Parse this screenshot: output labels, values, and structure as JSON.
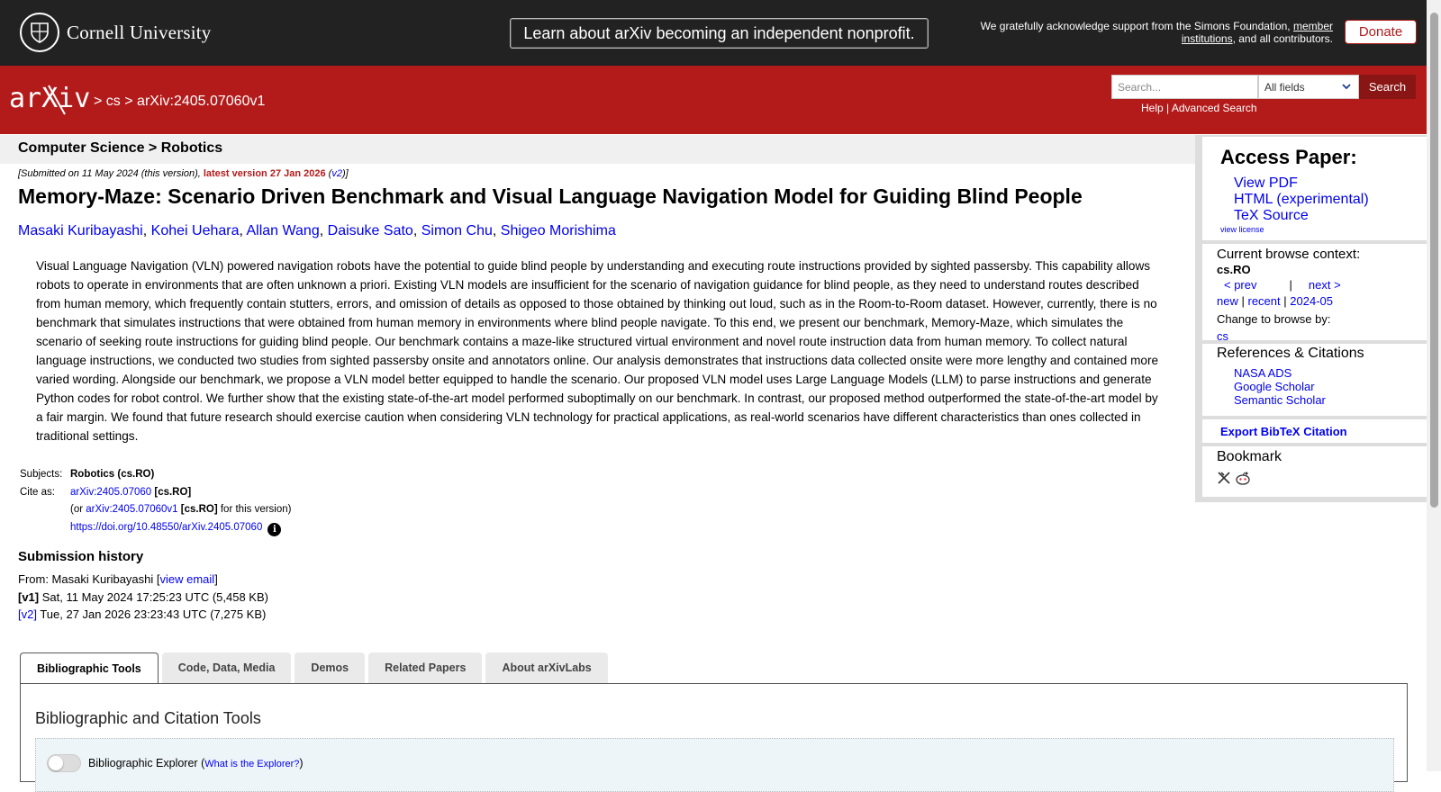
{
  "topbar": {
    "cornell_name": "Cornell University",
    "nonprofit_label": "Learn about arXiv becoming an independent nonprofit.",
    "support_text": "We gratefully acknowledge support from the Simons Foundation,",
    "support_link": "member institutions",
    "support_tail": ", and all contributors.",
    "donate_label": "Donate"
  },
  "header": {
    "logo_text": "arXiv",
    "crumb_sep1": ">",
    "crumb_cs": "cs",
    "crumb_sep2": ">",
    "crumb_paper": "arXiv:2405.07060v1",
    "search_placeholder": "Search...",
    "field_selected": "All fields",
    "search_button": "Search",
    "help": "Help",
    "pipe": "|",
    "advanced": "Advanced Search"
  },
  "paper": {
    "subject_bar": "Computer Science > Robotics",
    "submitted_prefix": "[Submitted on 11 May 2024 (this version), ",
    "latest": "latest version 27 Jan 2026",
    "v2_open": " (",
    "v2": "v2",
    "v2_close": ")]",
    "title": "Memory-Maze: Scenario Driven Benchmark and Visual Language Navigation Model for Guiding Blind People",
    "authors": [
      "Masaki Kuribayashi",
      "Kohei Uehara",
      "Allan Wang",
      "Daisuke Sato",
      "Simon Chu",
      "Shigeo Morishima"
    ],
    "author_sep": ",",
    "abstract": "Visual Language Navigation (VLN) powered navigation robots have the potential to guide blind people by understanding and executing route instructions provided by sighted passersby. This capability allows robots to operate in environments that are often unknown a priori. Existing VLN models are insufficient for the scenario of navigation guidance for blind people, as they need to understand routes described from human memory, which frequently contain stutters, errors, and omission of details as opposed to those obtained by thinking out loud, such as in the Room-to-Room dataset. However, currently, there is no benchmark that simulates instructions that were obtained from human memory in environments where blind people navigate. To this end, we present our benchmark, Memory-Maze, which simulates the scenario of seeking route instructions for guiding blind people. Our benchmark contains a maze-like structured virtual environment and novel route instruction data from human memory. To collect natural language instructions, we conducted two studies from sighted passersby onsite and annotators online. Our analysis demonstrates that instructions data collected onsite were more lengthy and contained more varied wording. Alongside our benchmark, we propose a VLN model better equipped to handle the scenario. Our proposed VLN model uses Large Language Models (LLM) to parse instructions and generate Python codes for robot control. We further show that the existing state-of-the-art model performed suboptimally on our benchmark. In contrast, our proposed method outperformed the state-of-the-art model by a fair margin. We found that future research should exercise caution when considering VLN technology for practical applications, as real-world scenarios have different characteristics than ones collected in traditional settings."
  },
  "meta": {
    "subjects_label": "Subjects:",
    "subjects_value": "Robotics (cs.RO)",
    "cite_label": "Cite as:",
    "cite_id": "arXiv:2405.07060",
    "cite_cat": "[cs.RO]",
    "or_prefix": "(or ",
    "cite_v1": "arXiv:2405.07060v1",
    "cite_v1_cat": "[cs.RO]",
    "or_suffix": " for this version)",
    "doi": "https://doi.org/10.48550/arXiv.2405.07060",
    "info_glyph": "i"
  },
  "history": {
    "title": "Submission history",
    "from_prefix": "From: Masaki Kuribayashi [",
    "view_email": "view email",
    "from_suffix": "]",
    "v1_label": "[v1]",
    "v1_date": " Sat, 11 May 2024 17:25:23 UTC (5,458 KB)",
    "v2_label": "[v2]",
    "v2_date": " Tue, 27 Jan 2026 23:23:43 UTC (7,275 KB)"
  },
  "tabs": [
    {
      "label": "Bibliographic Tools"
    },
    {
      "label": "Code, Data, Media"
    },
    {
      "label": "Demos"
    },
    {
      "label": "Related Papers"
    },
    {
      "label": "About arXivLabs"
    }
  ],
  "panel": {
    "title": "Bibliographic and Citation Tools",
    "explorer_label": "Bibliographic Explorer",
    "explorer_open": " (",
    "explorer_link": "What is the Explorer?",
    "explorer_close": ")"
  },
  "sidebar": {
    "access_title": "Access Paper:",
    "access_links": [
      "View PDF",
      "HTML (experimental)",
      "TeX Source"
    ],
    "view_license": "view license",
    "context_title": "Current browse context:",
    "context_value": "cs.RO",
    "prev": "< prev",
    "nav_sep": "|",
    "next": "next >",
    "new": "new",
    "recent": "recent",
    "month": "2024-05",
    "sep": "|",
    "change_label": "Change to browse by:",
    "browse_cs": "cs",
    "refs_title": "References & Citations",
    "refs_links": [
      "NASA ADS",
      "Google Scholar",
      "Semantic Scholar"
    ],
    "export": "Export BibTeX Citation",
    "bookmark_title": "Bookmark"
  },
  "colors": {
    "arxiv_red": "#b31b1b",
    "topbar": "#222222",
    "link": "#0000ee"
  }
}
